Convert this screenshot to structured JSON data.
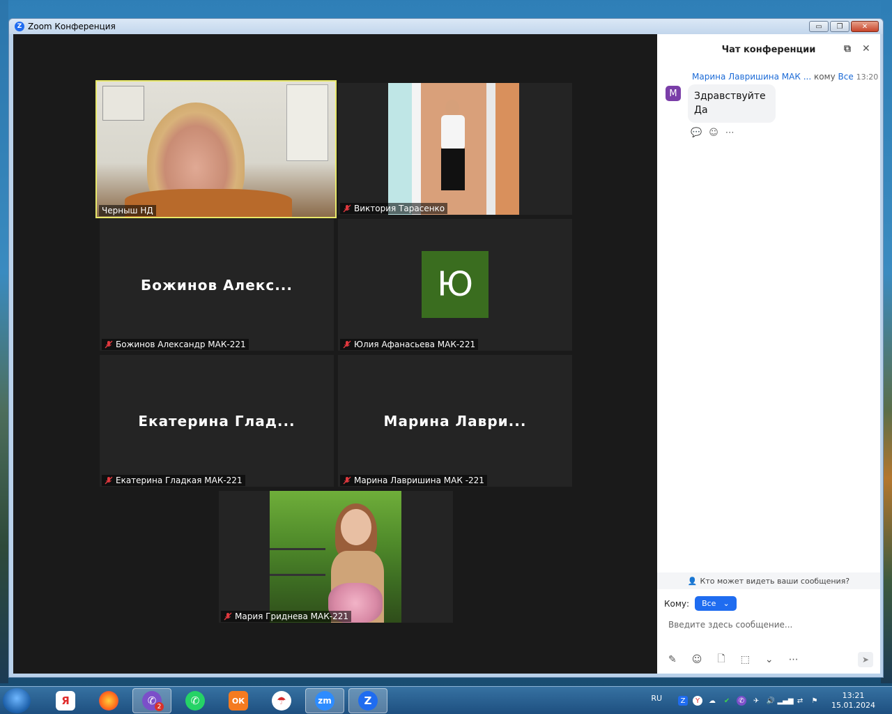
{
  "window": {
    "title": "Zoom Конференция",
    "minimize": "▭",
    "restore": "❐",
    "close": "✕"
  },
  "tiles": {
    "t1": {
      "name": "Черныш НД",
      "active": true
    },
    "t2": {
      "name": "Виктория Тарасенко",
      "muted": true
    },
    "t3": {
      "name": "Божинов Александр МАК-221",
      "big_name": "Божинов  Алекс...",
      "muted": true
    },
    "t4": {
      "name": "Юлия Афанасьева МАК-221",
      "avatar_letter": "Ю",
      "muted": true
    },
    "t5": {
      "name": "Екатерина Гладкая МАК-221",
      "big_name": "Екатерина  Глад...",
      "muted": true
    },
    "t6": {
      "name": "Марина Лавришина МАК -221",
      "big_name": "Марина  Лаври...",
      "muted": true
    },
    "t7": {
      "name": "Мария Гриднева МАК-221",
      "muted": true
    }
  },
  "chat": {
    "title": "Чат конференции",
    "message": {
      "avatar": "M",
      "sender": "Марина Лавришина МАК ...",
      "to_label": "кому",
      "to_who": "Все",
      "time": "13:20",
      "lines": [
        "Здравствуйте",
        "Да"
      ]
    },
    "who_sees": "Кто может видеть ваши сообщения?",
    "to_prefix": "Кому:",
    "to_value": "Все",
    "input_placeholder": "Введите здесь сообщение..."
  },
  "taskbar": {
    "lang": "RU",
    "time": "13:21",
    "date": "15.01.2024",
    "viber_badge": "2",
    "apps": [
      {
        "name": "yandex-browser",
        "glyph": "Я"
      },
      {
        "name": "firefox",
        "glyph": "🦊"
      },
      {
        "name": "viber",
        "glyph": "✆"
      },
      {
        "name": "whatsapp",
        "glyph": "✆"
      },
      {
        "name": "odnoklassniki",
        "glyph": "ОК"
      },
      {
        "name": "umbrella-app",
        "glyph": "☂"
      },
      {
        "name": "zoom-meetings",
        "glyph": "zm"
      },
      {
        "name": "zoom",
        "glyph": "Z"
      }
    ]
  },
  "colors": {
    "accent": "#1f6cf0",
    "active_speaker": "#e8e86a",
    "avatar_green": "#3a6d1f",
    "chat_avatar": "#7a3ea8",
    "video_bg": "#1a1a1a"
  }
}
